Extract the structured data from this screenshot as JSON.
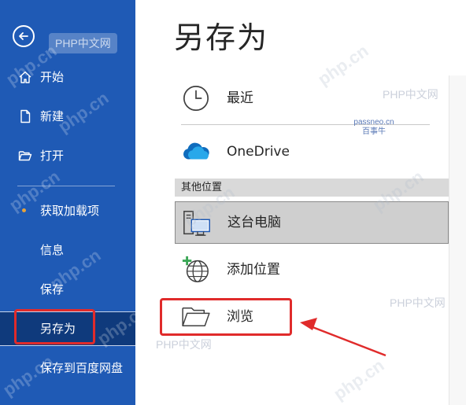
{
  "page_title": "另存为",
  "sidebar": {
    "back_icon": "back-arrow-icon",
    "items": [
      {
        "label": "开始",
        "icon": "home-icon"
      },
      {
        "label": "新建",
        "icon": "new-document-icon"
      },
      {
        "label": "打开",
        "icon": "folder-open-icon"
      },
      {
        "label": "获取加载项",
        "icon": "orange-dot"
      },
      {
        "label": "信息"
      },
      {
        "label": "保存"
      },
      {
        "label": "另存为",
        "active": true
      },
      {
        "label": "保存到百度网盘"
      }
    ]
  },
  "main": {
    "recent": {
      "label": "最近",
      "icon": "clock-icon"
    },
    "onedrive": {
      "label": "OneDrive",
      "icon": "cloud-icon"
    },
    "section_header": "其他位置",
    "this_pc": {
      "label": "这台电脑",
      "icon": "computer-icon"
    },
    "add_location": {
      "label": "添加位置",
      "icon": "globe-plus-icon"
    },
    "browse": {
      "label": "浏览",
      "icon": "folder-icon"
    }
  },
  "watermarks": {
    "php_cn": "PHP中文网",
    "php_diag": "php.cn",
    "passneo": "passneo.cn",
    "baishiniu": "百事牛"
  },
  "colors": {
    "sidebar_bg": "#1f5ab5",
    "sidebar_active": "#0f3a7c",
    "highlight_red": "#e02b2b",
    "onedrive_blue": "#0f6cbd"
  }
}
